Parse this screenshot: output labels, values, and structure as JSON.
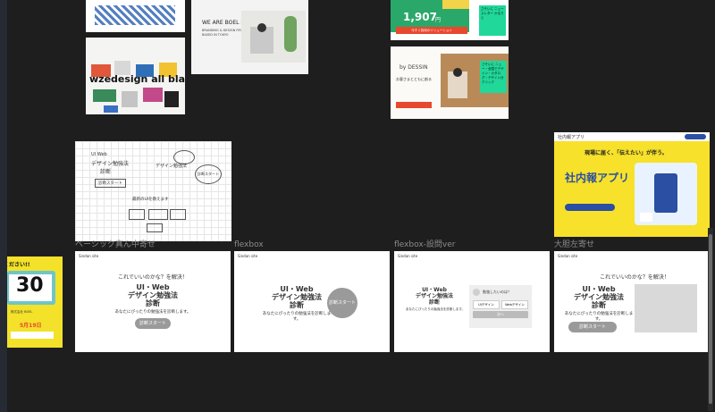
{
  "canvas": {
    "background": "#1e1e1e"
  },
  "thumbnails": {
    "design_all_blanc": {
      "text": "wzedesign all blanc"
    },
    "boel": {
      "title": "WE ARE BOEL Inc.",
      "line1": "BRANDING & DESIGN FIRM",
      "line2": "BASED IN TOKYO"
    },
    "green_ad": {
      "price": "1,907",
      "price_unit": "円",
      "cta": "今すぐ採用のソリューション",
      "bubble": "さそいに ニュースレター かるりと"
    },
    "dessin": {
      "logo": "by DESSIN",
      "headline": "お客さまとともに創る",
      "bubble": "さそいに ニュー・全国でデザイン・カタログ・デザイン分クリック"
    },
    "sketch": {
      "t1": "UI Web",
      "t2": "デザイン勉強法",
      "t3": "診断",
      "t4": "診断スタート",
      "t5": "最新のUIを教えます",
      "t6": "診断スタート"
    },
    "shanai": {
      "logo": "社内報アプリ",
      "head": "現場に届く、「伝えたい」が伴う。",
      "title": "社内報アプリ"
    },
    "yellow_left": {
      "text1": "ください!!",
      "num": "30",
      "date": "5月19日",
      "sub": "株式会社 BOEL"
    }
  },
  "frames": [
    {
      "label": "ベーシック真ん中寄せ",
      "site": "Sindan site",
      "question": "これでいいのかな？を解決！",
      "title1": "UI・Web",
      "title2": "デザイン勉強法",
      "title3": "診断",
      "desc": "あなたにぴったりの勉強法を診断します。",
      "button": "診断スタート"
    },
    {
      "label": "flexbox",
      "site": "Sindan site",
      "title1": "UI・Web",
      "title2": "デザイン勉強法",
      "title3": "診断",
      "desc": "あなたにぴったりの勉強法を診断します。",
      "button": "診断スタート"
    },
    {
      "label": "flexbox-設問ver",
      "site": "Sindan site",
      "title1": "UI・Web",
      "title2": "デザイン勉強法",
      "title3": "診断",
      "desc": "あなたにぴったりの勉強法を診断します。",
      "q": "勉強したいのは？",
      "opt1": "UIデザイン",
      "opt2": "Webデザイン",
      "next": "次へ"
    },
    {
      "label": "大胆左寄せ",
      "site": "Sindan site",
      "question": "これでいいのかな？を解決！",
      "title1": "UI・Web",
      "title2": "デザイン勉強法",
      "title3": "診断",
      "desc": "あなたにぴったりの勉強法を診断します。",
      "button": "診断スタート"
    }
  ]
}
